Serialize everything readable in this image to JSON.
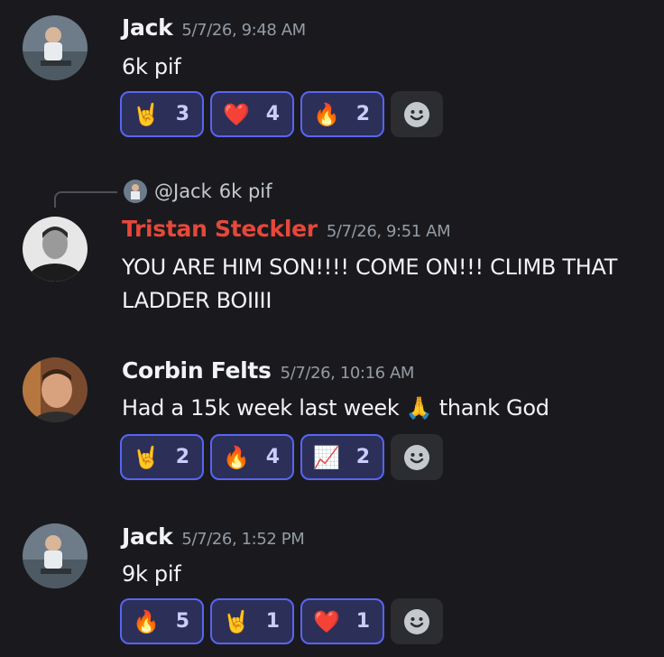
{
  "messages": [
    {
      "author": "Jack",
      "time": "5/7/26, 9:48 AM",
      "text": "6k pif",
      "reactions": [
        {
          "emoji": "🤘",
          "count": "3"
        },
        {
          "emoji": "❤️",
          "count": "4"
        },
        {
          "emoji": "🔥",
          "count": "2"
        }
      ]
    },
    {
      "reply_to": {
        "mention": "@Jack",
        "text": "6k pif"
      },
      "author": "Tristan Steckler",
      "time": "5/7/26, 9:51 AM",
      "text_line1": "YOU ARE HIM SON!!!! COME ON!!! CLIMB THAT",
      "text_line2": "LADDER BOIIII"
    },
    {
      "author": "Corbin Felts",
      "time": "5/7/26, 10:16 AM",
      "text_before": "Had a 15k week last week",
      "inline_emoji": "🙏",
      "text_after": "thank God",
      "reactions": [
        {
          "emoji": "🤘",
          "count": "2"
        },
        {
          "emoji": "🔥",
          "count": "4"
        },
        {
          "emoji": "📈",
          "count": "2"
        }
      ]
    },
    {
      "author": "Jack",
      "time": "5/7/26, 1:52 PM",
      "text": "9k pif",
      "reactions": [
        {
          "emoji": "🔥",
          "count": "5"
        },
        {
          "emoji": "🤘",
          "count": "1"
        },
        {
          "emoji": "❤️",
          "count": "1"
        }
      ]
    }
  ],
  "colors": {
    "background": "#1a1a1e",
    "reaction_border": "#5865f2",
    "reaction_bg": "#2c2f58",
    "role_red": "#e5483a"
  }
}
